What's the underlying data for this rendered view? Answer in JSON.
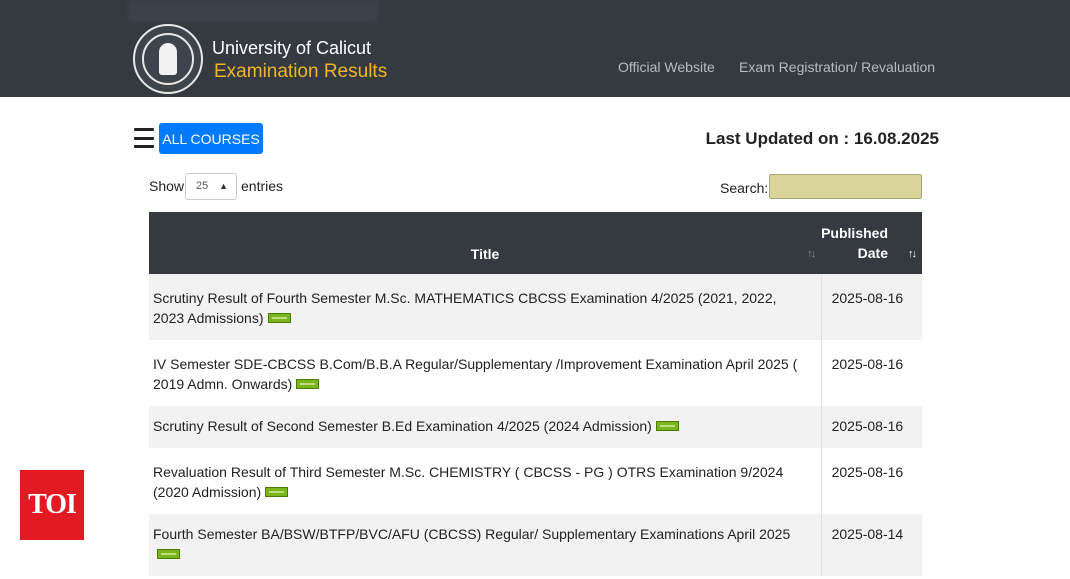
{
  "header": {
    "university": "University of Calicut",
    "subtitle": "Examination Results",
    "nav": [
      "Official Website",
      "Exam Registration/ Revaluation"
    ]
  },
  "toolbar": {
    "all_courses_label": "ALL COURSES",
    "last_updated": "Last Updated on : 16.08.2025"
  },
  "controls": {
    "show_label": "Show",
    "entries_value": "25",
    "entries_label": "entries",
    "search_label": "Search:",
    "search_value": ""
  },
  "table": {
    "headers": {
      "title": "Title",
      "date_line1": "Published",
      "date_line2": "Date"
    },
    "rows": [
      {
        "title": "Scrutiny Result of Fourth Semester M.Sc. MATHEMATICS CBCSS Examination 4/2025 (2021, 2022, 2023 Admissions)",
        "date": "2025-08-16"
      },
      {
        "title": "IV Semester SDE-CBCSS B.Com/B.B.A Regular/Supplementary /Improvement Examination April 2025 ( 2019 Admn. Onwards)",
        "date": "2025-08-16"
      },
      {
        "title": "Scrutiny Result of Second Semester B.Ed Examination 4/2025 (2024 Admission)",
        "date": "2025-08-16"
      },
      {
        "title": "Revaluation Result of Third Semester M.Sc. CHEMISTRY ( CBCSS - PG ) OTRS Examination 9/2024 (2020 Admission)",
        "date": "2025-08-16"
      },
      {
        "title": "Fourth Semester BA/BSW/BTFP/BVC/AFU (CBCSS) Regular/ Supplementary Examinations April 2025",
        "date": "2025-08-14"
      }
    ]
  },
  "watermark": {
    "text": "TOI"
  },
  "colors": {
    "header_bg": "#343a40",
    "accent_yellow": "#f0b429",
    "primary_blue": "#007bff",
    "new_badge": "#7ab51d",
    "toi_red": "#e21b22"
  }
}
